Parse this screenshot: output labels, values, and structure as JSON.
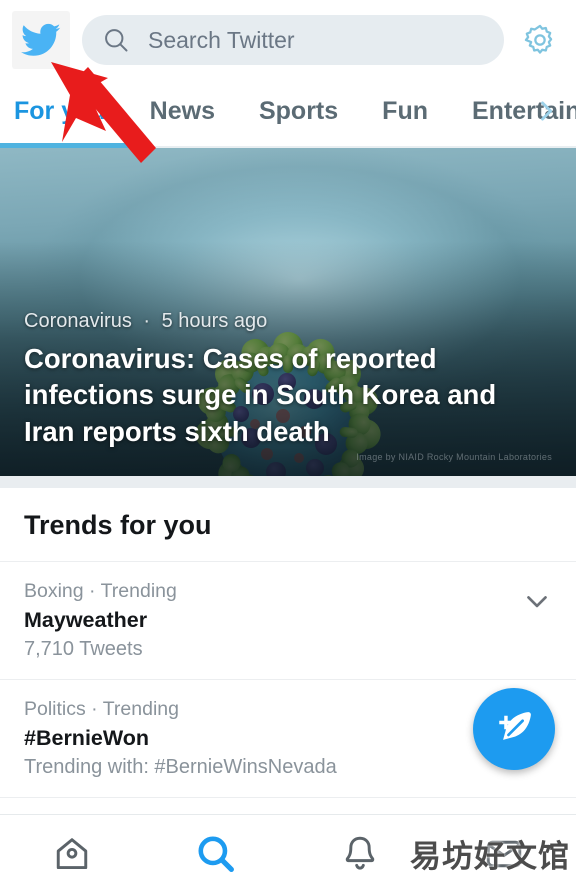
{
  "app": {
    "name": "Twitter",
    "logo_icon": "twitter-bird-icon"
  },
  "header": {
    "search": {
      "placeholder": "Search Twitter",
      "icon": "search-icon"
    },
    "settings": {
      "icon": "gear-icon",
      "label": "Settings"
    }
  },
  "tabs": {
    "items": [
      {
        "label": "For you",
        "active": true
      },
      {
        "label": "News",
        "active": false
      },
      {
        "label": "Sports",
        "active": false
      },
      {
        "label": "Fun",
        "active": false
      },
      {
        "label": "Entertainment",
        "active": false
      }
    ],
    "more_icon": "chevron-right-icon"
  },
  "news_card": {
    "category": "Coronavirus",
    "separator": "·",
    "timestamp": "5 hours ago",
    "headline": "Coronavirus: Cases of reported infections surge in South Korea and Iran reports sixth death",
    "image_credit": "Image by NIAID Rocky Mountain Laboratories",
    "image_alt": "coronavirus-particle-image"
  },
  "trends": {
    "title": "Trends for you",
    "items": [
      {
        "category": "Boxing · Trending",
        "name": "Mayweather",
        "sub": "7,710 Tweets",
        "chevron_icon": "chevron-down-icon"
      },
      {
        "category": "Politics · Trending",
        "name": "#BernieWon",
        "sub": "Trending with: #BernieWinsNevada",
        "chevron_icon": "chevron-down-icon"
      }
    ]
  },
  "compose": {
    "label": "Compose Tweet",
    "icon": "feather-plus-icon"
  },
  "bottom_nav": {
    "items": [
      {
        "name": "home",
        "icon": "home-icon",
        "active": false
      },
      {
        "name": "search",
        "icon": "search-icon",
        "active": true
      },
      {
        "name": "notifications",
        "icon": "bell-icon",
        "active": false
      },
      {
        "name": "messages",
        "icon": "envelope-icon",
        "active": false
      }
    ]
  },
  "watermark": {
    "text": "易坊好文馆"
  },
  "annotation": {
    "type": "red-arrow",
    "points_to": "twitter-bird-icon"
  },
  "colors": {
    "brand_blue": "#1d9bf0",
    "tab_active": "#1b95e0",
    "tab_inactive": "#5b6b74",
    "search_bg": "#e6ecf0",
    "text_primary": "#14171a",
    "text_muted": "#8a939b",
    "annotation_red": "#e81c1c"
  }
}
